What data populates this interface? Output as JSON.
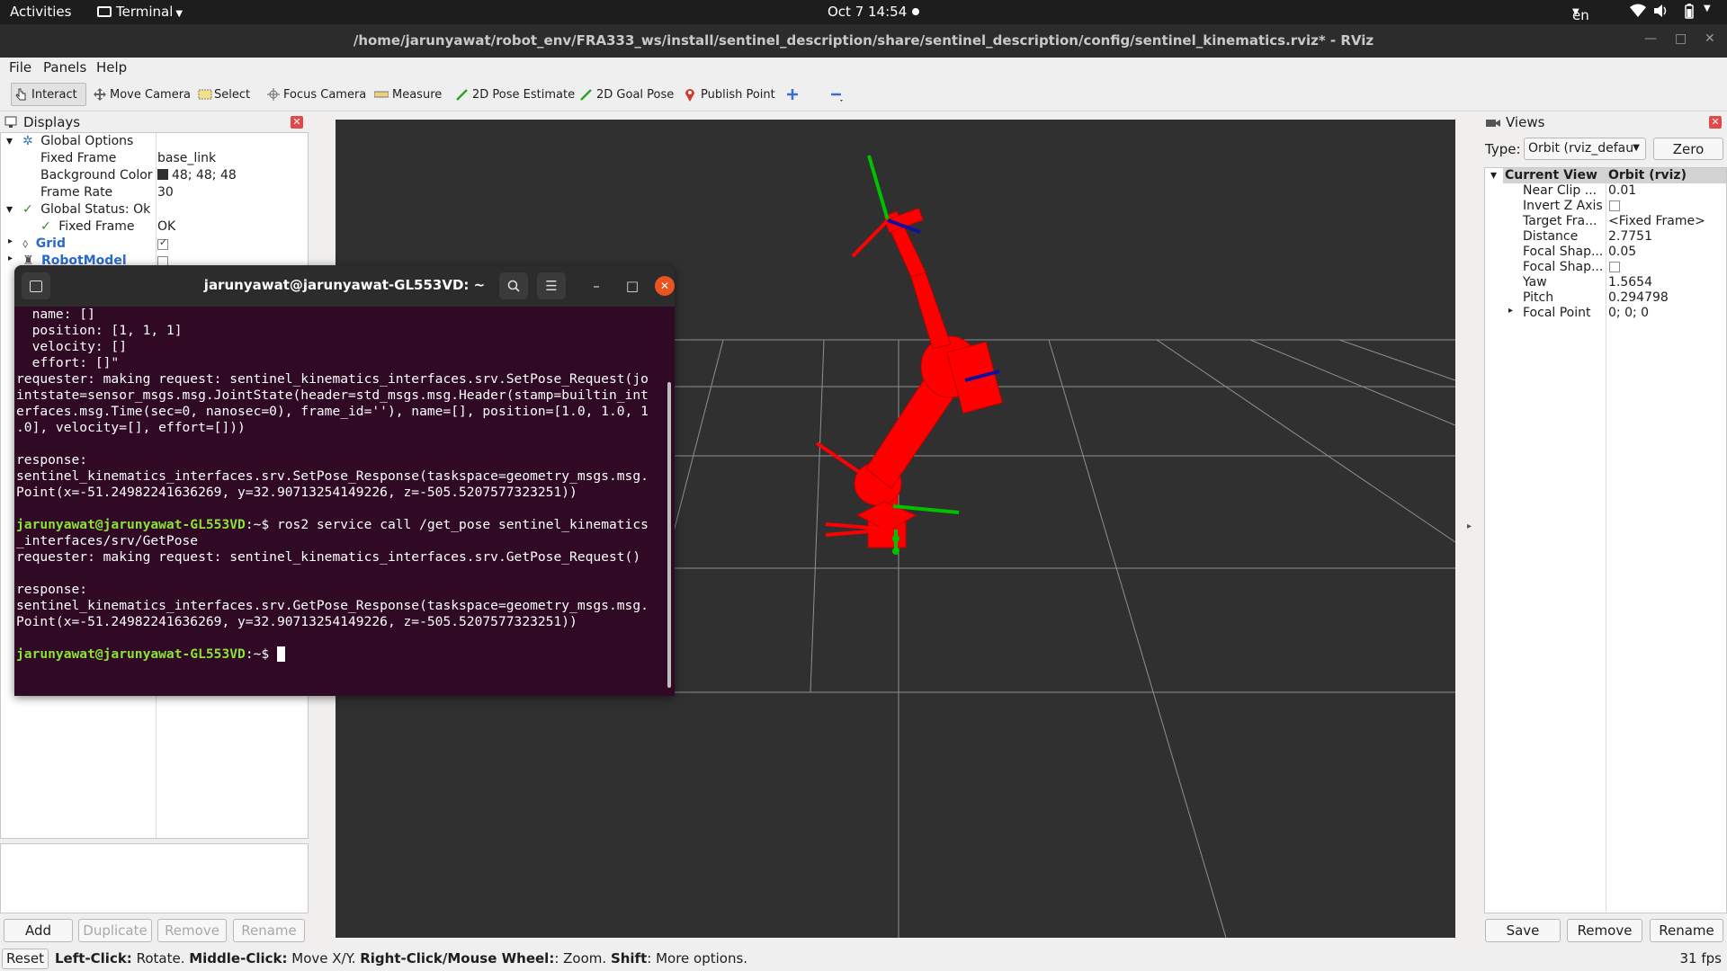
{
  "topbar": {
    "activities": "Activities",
    "app": "Terminal",
    "datetime": "Oct 7  14:54",
    "lang": "en"
  },
  "window": {
    "title": "/home/jarunyawat/robot_env/FRA333_ws/install/sentinel_description/share/sentinel_description/config/sentinel_kinematics.rviz* - RViz"
  },
  "menu": {
    "file": "File",
    "panels": "Panels",
    "help": "Help"
  },
  "toolbar": {
    "interact": "Interact",
    "move_camera": "Move Camera",
    "select": "Select",
    "focus_camera": "Focus Camera",
    "measure": "Measure",
    "pose_estimate": "2D Pose Estimate",
    "goal_pose": "2D Goal Pose",
    "publish_point": "Publish Point"
  },
  "displays": {
    "title": "Displays",
    "global_options": "Global Options",
    "fixed_frame_label": "Fixed Frame",
    "fixed_frame_value": "base_link",
    "bg_color_label": "Background Color",
    "bg_color_value": "48; 48; 48",
    "frame_rate_label": "Frame Rate",
    "frame_rate_value": "30",
    "global_status": "Global Status: Ok",
    "status_fixed_frame_label": "Fixed Frame",
    "status_fixed_frame_value": "OK",
    "grid": "Grid",
    "robot_model": "RobotModel",
    "buttons": {
      "add": "Add",
      "duplicate": "Duplicate",
      "remove": "Remove",
      "rename": "Rename"
    }
  },
  "terminal": {
    "title": "jarunyawat@jarunyawat-GL553VD: ~",
    "prompt": "jarunyawat@jarunyawat-GL553VD",
    "prompt_suffix": ":~$ ",
    "lines": [
      "  name: []",
      "  position: [1, 1, 1]",
      "  velocity: []",
      "  effort: []\"",
      "requester: making request: sentinel_kinematics_interfaces.srv.SetPose_Request(jo",
      "intstate=sensor_msgs.msg.JointState(header=std_msgs.msg.Header(stamp=builtin_int",
      "erfaces.msg.Time(sec=0, nanosec=0), frame_id=''), name=[], position=[1.0, 1.0, 1",
      ".0], velocity=[], effort=[]))",
      "",
      "response:",
      "sentinel_kinematics_interfaces.srv.SetPose_Response(taskspace=geometry_msgs.msg.",
      "Point(x=-51.24982241636269, y=32.90713254149226, z=-505.5207577323251))",
      ""
    ],
    "cmd": "ros2 service call /get_pose sentinel_kinematics",
    "cmd_cont": "_interfaces/srv/GetPose",
    "lines2": [
      "requester: making request: sentinel_kinematics_interfaces.srv.GetPose_Request()",
      "",
      "response:",
      "sentinel_kinematics_interfaces.srv.GetPose_Response(taskspace=geometry_msgs.msg.",
      "Point(x=-51.24982241636269, y=32.90713254149226, z=-505.5207577323251))",
      ""
    ]
  },
  "views": {
    "title": "Views",
    "type_label": "Type:",
    "type_value": "Orbit (rviz_defau",
    "zero": "Zero",
    "header_name": "Current View",
    "header_value": "Orbit (rviz)",
    "props": [
      {
        "name": "Near Clip ...",
        "value": "0.01"
      },
      {
        "name": "Invert Z Axis",
        "value": ""
      },
      {
        "name": "Target Fra...",
        "value": "<Fixed Frame>"
      },
      {
        "name": "Distance",
        "value": "2.7751"
      },
      {
        "name": "Focal Shap...",
        "value": "0.05"
      },
      {
        "name": "Focal Shap...",
        "value": ""
      },
      {
        "name": "Yaw",
        "value": "1.5654"
      },
      {
        "name": "Pitch",
        "value": "0.294798"
      },
      {
        "name": "Focal Point",
        "value": "0; 0; 0"
      }
    ],
    "buttons": {
      "save": "Save",
      "remove": "Remove",
      "rename": "Rename"
    }
  },
  "status": {
    "reset": "Reset",
    "hint_a": "Left-Click:",
    "hint_b": " Rotate. ",
    "hint_c": "Middle-Click:",
    "hint_d": " Move X/Y. ",
    "hint_e": "Right-Click/Mouse Wheel:",
    "hint_f": ": Zoom. ",
    "hint_g": "Shift",
    "hint_h": ": More options.",
    "fps": "31 fps"
  },
  "colors": {
    "robot": "#ff0000",
    "viewport_bg": "#303030",
    "terminal_bg": "#300a24",
    "prompt": "#8ae234"
  }
}
